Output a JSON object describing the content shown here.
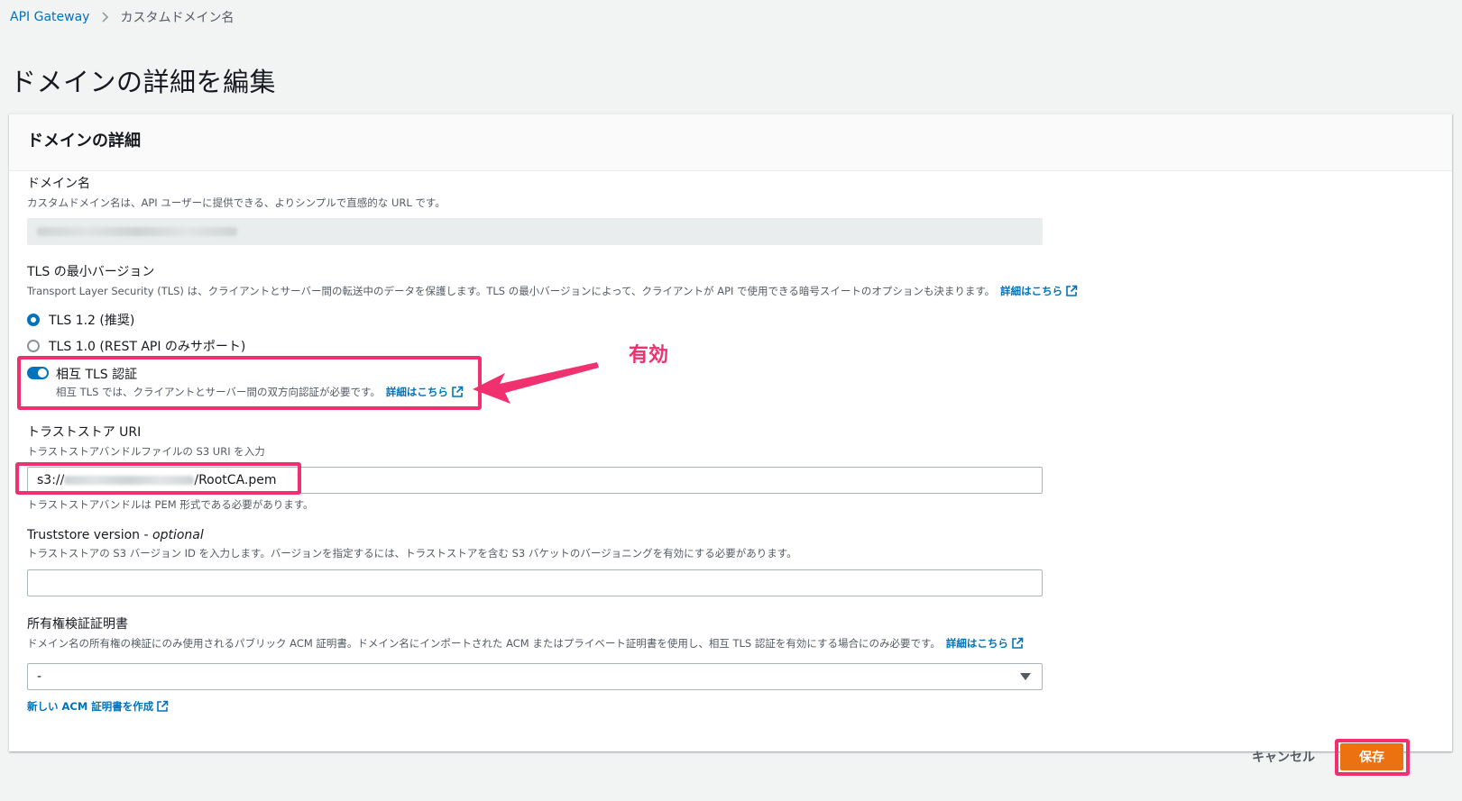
{
  "breadcrumb": {
    "root": "API Gateway",
    "current": "カスタムドメイン名"
  },
  "page_title": "ドメインの詳細を編集",
  "panel": {
    "title": "ドメインの詳細"
  },
  "domain_name": {
    "label": "ドメイン名",
    "description": "カスタムドメイン名は、API ユーザーに提供できる、よりシンプルで直感的な URL です。"
  },
  "tls": {
    "label": "TLS の最小バージョン",
    "description": "Transport Layer Security (TLS) は、クライアントとサーバー間の転送中のデータを保護します。TLS の最小バージョンによって、クライアントが API で使用できる暗号スイートのオプションも決まります。",
    "learn_more": "詳細はこちら",
    "options": [
      "TLS 1.2 (推奨)",
      "TLS 1.0 (REST API のみサポート)"
    ],
    "selected": "TLS 1.2 (推奨)"
  },
  "mutual_tls": {
    "label": "相互 TLS 認証",
    "description": "相互 TLS では、クライアントとサーバー間の双方向認証が必要です。",
    "learn_more": "詳細はこちら",
    "enabled": true
  },
  "annotation": "有効",
  "truststore": {
    "label": "トラストストア URI",
    "description": "トラストストアバンドルファイルの S3 URI を入力",
    "value_prefix": "s3://",
    "value_suffix": "/RootCA.pem",
    "hint": "トラストストアバンドルは PEM 形式である必要があります。"
  },
  "truststore_version": {
    "label": "Truststore version - ",
    "label_optional": "optional",
    "description": "トラストストアの S3 バージョン ID を入力します。バージョンを指定するには、トラストストアを含む S3 バケットのバージョニングを有効にする必要があります。",
    "value": ""
  },
  "ownership_cert": {
    "label": "所有権検証証明書",
    "description": "ドメイン名の所有権の検証にのみ使用されるパブリック ACM 証明書。ドメイン名にインポートされた ACM またはプライベート証明書を使用し、相互 TLS 認証を有効にする場合にのみ必要です。",
    "learn_more": "詳細はこちら",
    "selected": "-",
    "create_link": "新しい ACM 証明書を作成"
  },
  "footer": {
    "cancel": "キャンセル",
    "save": "保存"
  },
  "colors": {
    "link": "#0073bb",
    "primary": "#ec7211",
    "highlight": "#f0306f"
  }
}
